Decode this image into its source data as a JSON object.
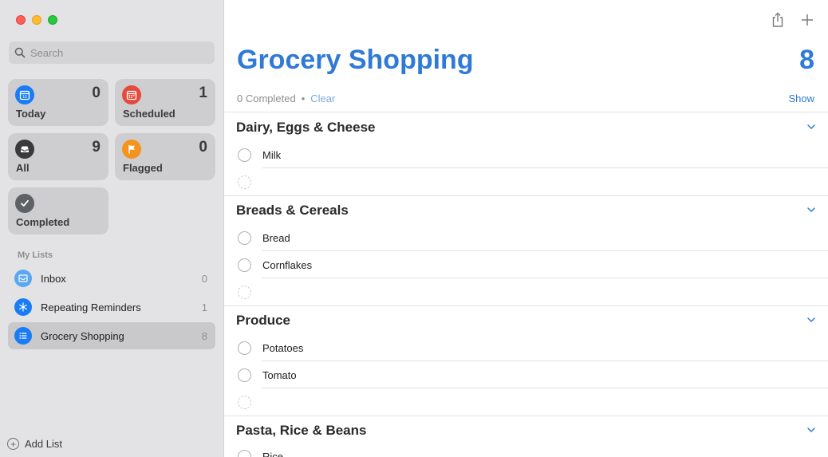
{
  "sidebar": {
    "search_placeholder": "Search",
    "smart_lists": [
      {
        "label": "Today",
        "count": "0",
        "icon": "calendar-icon",
        "color": "#1a7cf5"
      },
      {
        "label": "Scheduled",
        "count": "1",
        "icon": "calendar-grid-icon",
        "color": "#e64a3b"
      },
      {
        "label": "All",
        "count": "9",
        "icon": "tray-icon",
        "color": "#3a3a3c"
      },
      {
        "label": "Flagged",
        "count": "0",
        "icon": "flag-icon",
        "color": "#f4941e"
      },
      {
        "label": "Completed",
        "count": "",
        "icon": "checkmark-icon",
        "color": "#5e6166"
      }
    ],
    "my_lists_heading": "My Lists",
    "lists": [
      {
        "name": "Inbox",
        "count": "0",
        "icon": "inbox-icon",
        "color": "#5aa7f2"
      },
      {
        "name": "Repeating Reminders",
        "count": "1",
        "icon": "snowflake-icon",
        "color": "#1a7cf5"
      },
      {
        "name": "Grocery Shopping",
        "count": "8",
        "icon": "list-bullet-icon",
        "color": "#1a7cf5",
        "selected": true
      }
    ],
    "add_list_label": "Add List"
  },
  "main": {
    "title": "Grocery Shopping",
    "count": "8",
    "completed_text": "0 Completed",
    "separator": "•",
    "clear_label": "Clear",
    "show_label": "Show",
    "accent_color": "#2f7ad6",
    "sections": [
      {
        "title": "Dairy, Eggs & Cheese",
        "items": [
          "Milk"
        ]
      },
      {
        "title": "Breads & Cereals",
        "items": [
          "Bread",
          "Cornflakes"
        ]
      },
      {
        "title": "Produce",
        "items": [
          "Potatoes",
          "Tomato"
        ]
      },
      {
        "title": "Pasta, Rice & Beans",
        "items": [
          "Rice"
        ]
      }
    ]
  }
}
